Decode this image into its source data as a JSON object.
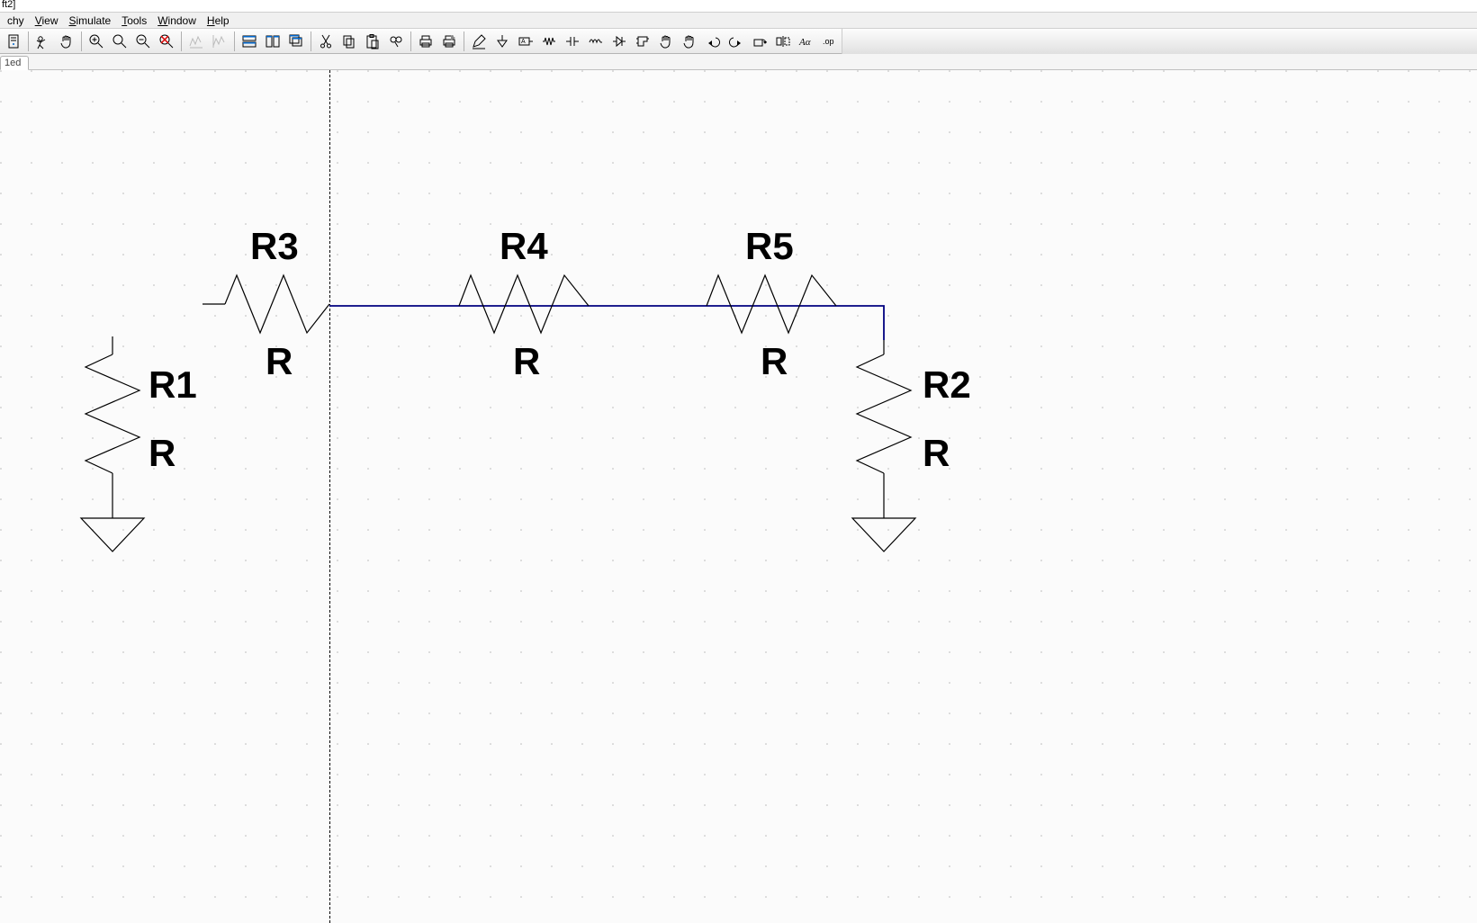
{
  "window": {
    "title_fragment": "ft2]"
  },
  "menu": {
    "items": [
      {
        "label": "chy",
        "u": ""
      },
      {
        "label": "View",
        "u": "V"
      },
      {
        "label": "Simulate",
        "u": "S"
      },
      {
        "label": "Tools",
        "u": "T"
      },
      {
        "label": "Window",
        "u": "W"
      },
      {
        "label": "Help",
        "u": "H"
      }
    ]
  },
  "tab": {
    "label": "1ed"
  },
  "toolbar": {
    "icons": [
      "schematic-icon",
      "run-icon",
      "pan-hand-icon",
      "sep",
      "zoom-in-icon",
      "zoom-area-icon",
      "zoom-out-icon",
      "zoom-fit-icon",
      "sep",
      "autoscale-x-icon",
      "autoscale-y-icon",
      "sep",
      "tile-h-icon",
      "tile-v-icon",
      "cascade-icon",
      "sep",
      "cut-icon",
      "copy-icon",
      "paste-icon",
      "find-icon",
      "sep",
      "print-icon",
      "print-setup-icon",
      "sep",
      "pencil-icon",
      "ground-icon",
      "label-net-icon",
      "resistor-icon",
      "capacitor-icon",
      "inductor-icon",
      "diode-icon",
      "component-icon",
      "move-icon",
      "drag-icon",
      "undo-icon",
      "redo-icon",
      "rotate-icon",
      "mirror-icon",
      "text-Aa-icon",
      "op-icon"
    ]
  },
  "schematic": {
    "components": [
      {
        "ref": "R1",
        "value": "R"
      },
      {
        "ref": "R2",
        "value": "R"
      },
      {
        "ref": "R3",
        "value": "R"
      },
      {
        "ref": "R4",
        "value": "R"
      },
      {
        "ref": "R5",
        "value": "R"
      }
    ]
  }
}
